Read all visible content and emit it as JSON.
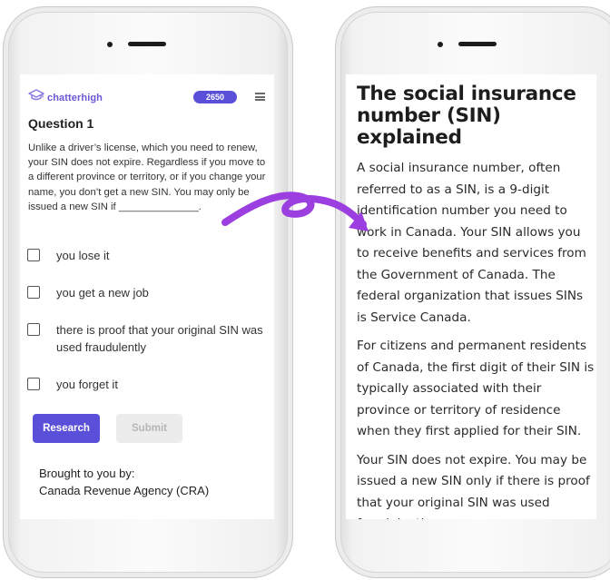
{
  "left_phone": {
    "app": {
      "logo_text": "chatterhigh",
      "points": "2650"
    },
    "question": {
      "title": "Question 1",
      "text": "Unlike a driver’s license, which you need to renew, your SIN does not expire. Regardless if you move to a different province or territory, or if you change your name, you don’t get a new SIN. You may only be issued a new SIN if ______________."
    },
    "options": [
      {
        "label": "you lose it"
      },
      {
        "label": "you get a new job"
      },
      {
        "label": "there is proof that your original SIN was used fraudulently"
      },
      {
        "label": "you forget it"
      }
    ],
    "buttons": {
      "research": "Research",
      "submit": "Submit"
    },
    "sponsor": {
      "label": "Brought to you by:",
      "org": "Canada Revenue Agency (CRA)"
    }
  },
  "right_phone": {
    "article": {
      "title": "The social insurance number (SIN) explained",
      "paragraphs": [
        "A social insurance number, often referred to as a SIN, is a 9-digit identification number you need to work in Canada. Your SIN allows you to receive benefits and services from the Government of Canada. The federal organization that issues SINs is Service Canada.",
        "For citizens and permanent residents of Canada, the first digit of their SIN is typically associated with their province or territory of residence when they first applied for their SIN.",
        "Your SIN does not expire. You may be issued a new SIN only if there is proof that your original SIN was used fraudulently."
      ]
    }
  },
  "colors": {
    "brand_purple": "#5a4fd8",
    "arrow_purple": "#9b3fe0",
    "submit_disabled_bg": "#ececec"
  },
  "icons": [
    "graduation-cap-icon",
    "hamburger-menu-icon",
    "curved-arrow-icon"
  ]
}
